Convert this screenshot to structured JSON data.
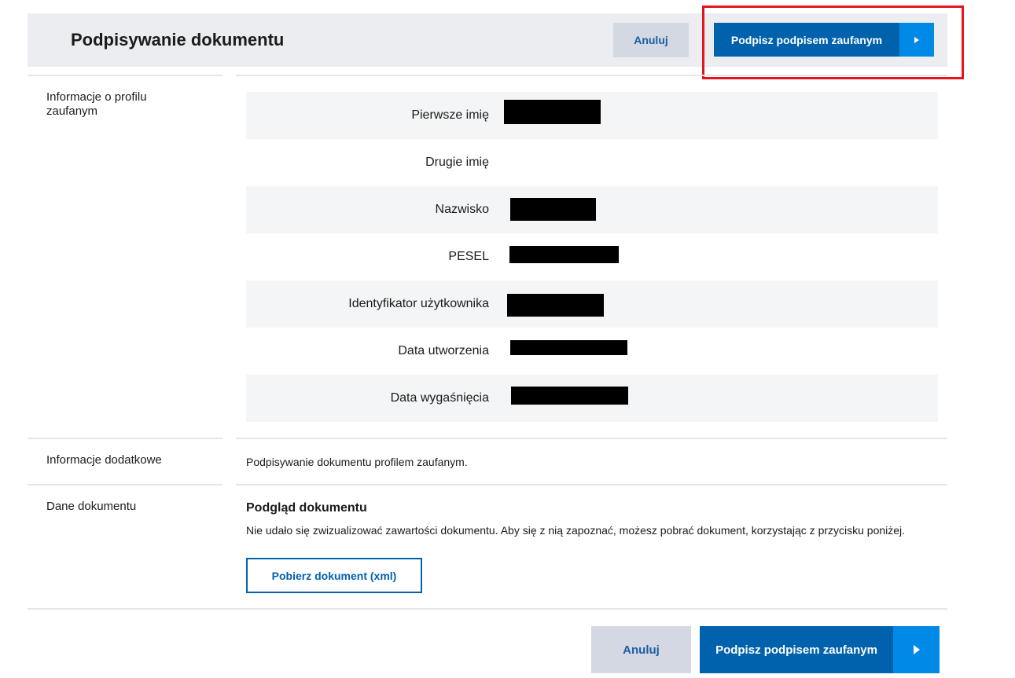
{
  "header": {
    "title": "Podpisywanie dokumentu",
    "cancel_label": "Anuluj",
    "sign_label": "Podpisz podpisem zaufanym"
  },
  "profile": {
    "section_label": "Informacje o profilu zaufanym",
    "fields": [
      {
        "label": "Pierwsze imię",
        "value": "redacted"
      },
      {
        "label": "Drugie imię",
        "value": ""
      },
      {
        "label": "Nazwisko",
        "value": "redacted"
      },
      {
        "label": "PESEL",
        "value": "redacted"
      },
      {
        "label": "Identyfikator użytkownika",
        "value": "redacted"
      },
      {
        "label": "Data utworzenia",
        "value": "redacted"
      },
      {
        "label": "Data wygaśnięcia",
        "value": "redacted"
      }
    ]
  },
  "additional": {
    "section_label": "Informacje dodatkowe",
    "text": "Podpisywanie dokumentu profilem zaufanym."
  },
  "document": {
    "section_label": "Dane dokumentu",
    "preview_title": "Podgląd dokumentu",
    "preview_note": "Nie udało się zwizualizować zawartości dokumentu. Aby się z nią zapoznać, możesz pobrać dokument, korzystając z przycisku poniżej.",
    "download_label": "Pobierz dokument (xml)"
  },
  "footer": {
    "cancel_label": "Anuluj",
    "sign_label": "Podpisz podpisem zaufanym"
  },
  "colors": {
    "primary": "#0062ad",
    "primary_arrow": "#0089e6",
    "cancel_bg": "#d4d8e2",
    "highlight": "#e5141e"
  }
}
